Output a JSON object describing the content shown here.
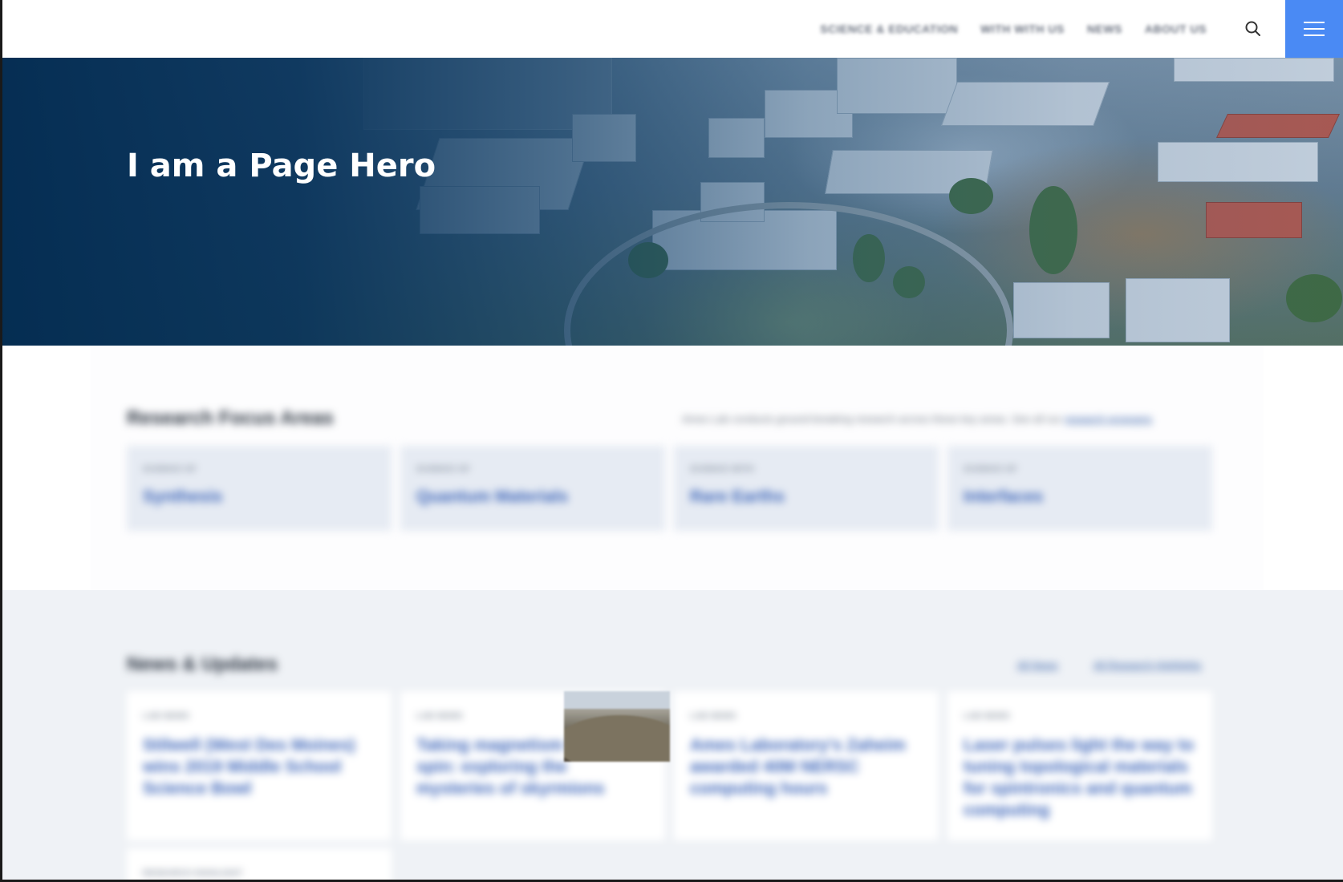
{
  "header": {
    "nav": [
      "SCIENCE & EDUCATION",
      "WITH WITH US",
      "NEWS",
      "ABOUT US"
    ]
  },
  "hero": {
    "title": "I am a Page Hero"
  },
  "focus": {
    "title": "Research Focus Areas",
    "description": "Ames Lab conducts ground-breaking research across these key areas. See all our",
    "description_link": "research programs",
    "cards": [
      {
        "kicker": "SCIENCE OF",
        "title": "Synthesis"
      },
      {
        "kicker": "SCIENCE OF",
        "title": "Quantum Materials"
      },
      {
        "kicker": "SCIENCE WITH",
        "title": "Rare Earths"
      },
      {
        "kicker": "SCIENCE OF",
        "title": "Interfaces"
      }
    ]
  },
  "news": {
    "title": "News & Updates",
    "links": [
      "All News",
      "All Research Highlights"
    ],
    "cards": [
      {
        "kicker": "LAB NEWS",
        "title": "Stilwell (West Des Moines) wins 2019 Middle School Science Bowl"
      },
      {
        "kicker": "LAB NEWS",
        "title": "Taking magnetism for a spin: exploring the mysteries of skyrmions"
      },
      {
        "kicker": "LAB NEWS",
        "title": "Ames Laboratory's Zaheim awarded 40M NERSC computing hours"
      },
      {
        "kicker": "LAB NEWS",
        "title": "Laser pulses light the way to tuning topological materials for spintronics and quantum computing"
      }
    ],
    "partial_kicker": "RESEARCH HIGHLIGHT"
  }
}
